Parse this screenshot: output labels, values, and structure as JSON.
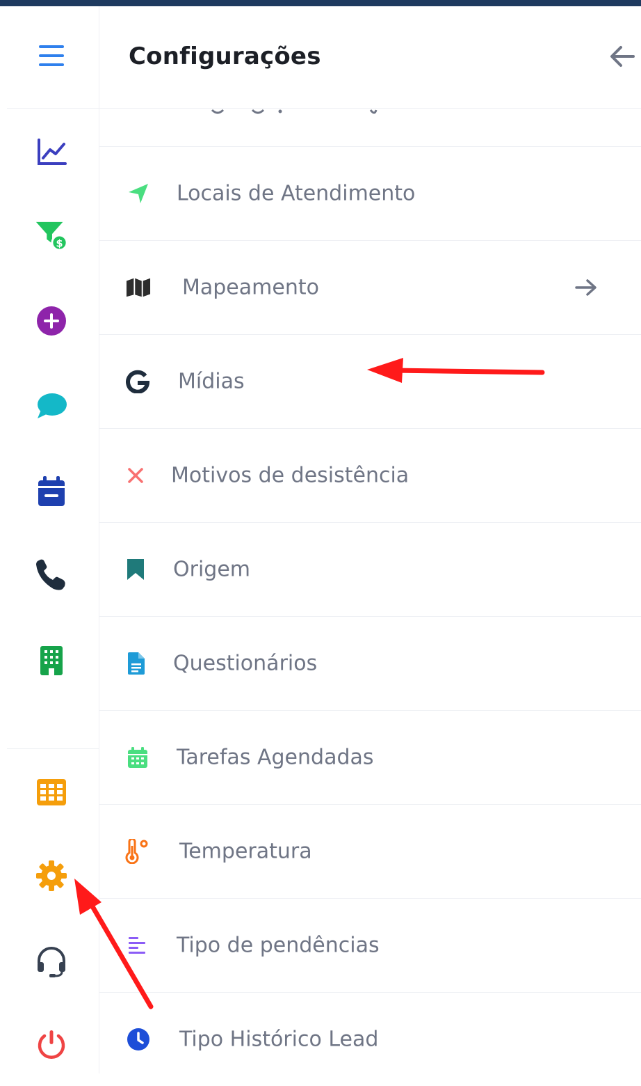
{
  "header": {
    "title": "Configurações",
    "back_icon": "arrow-left-icon"
  },
  "sidebar": {
    "top_items": [
      {
        "icon": "menu-icon",
        "color": "#2f80ed"
      },
      {
        "icon": "chart-line-icon",
        "color": "#3b3fbf"
      },
      {
        "icon": "funnel-dollar-icon",
        "color": "#22c55e"
      },
      {
        "icon": "plus-circle-icon",
        "color": "#8e24aa"
      },
      {
        "icon": "chat-bubble-icon",
        "color": "#14b8c8"
      },
      {
        "icon": "calendar-icon",
        "color": "#1e40af"
      },
      {
        "icon": "phone-icon",
        "color": "#1f2d3d"
      },
      {
        "icon": "building-icon",
        "color": "#16a34a"
      }
    ],
    "bottom_items": [
      {
        "icon": "grid-icon",
        "color": "#f59e0b"
      },
      {
        "icon": "gear-icon",
        "color": "#f59e0b"
      },
      {
        "icon": "headset-icon",
        "color": "#374151"
      },
      {
        "icon": "power-icon",
        "color": "#ef4444"
      }
    ]
  },
  "settings_list": {
    "items": [
      {
        "label": "Locais de Atendimento",
        "icon": "location-arrow-icon",
        "icon_color": "#4ade80"
      },
      {
        "label": "Mapeamento",
        "icon": "map-icon",
        "icon_color": "#2d2d2d",
        "has_arrow": true
      },
      {
        "label": "Mídias",
        "icon": "google-icon",
        "icon_color": "#1f2d3d"
      },
      {
        "label": "Motivos de desistência",
        "icon": "close-icon",
        "icon_color": "#f87171"
      },
      {
        "label": "Origem",
        "icon": "bookmark-icon",
        "icon_color": "#1f7a7a"
      },
      {
        "label": "Questionários",
        "icon": "document-icon",
        "icon_color": "#1e9bd7"
      },
      {
        "label": "Tarefas Agendadas",
        "icon": "calendar-grid-icon",
        "icon_color": "#4ade80"
      },
      {
        "label": "Temperatura",
        "icon": "thermometer-icon",
        "icon_color": "#f97316"
      },
      {
        "label": "Tipo de pendências",
        "icon": "align-left-icon",
        "icon_color": "#8b5cf6"
      },
      {
        "label": "Tipo Histórico Lead",
        "icon": "clock-icon",
        "icon_color": "#1d4ed8"
      }
    ]
  },
  "colors": {
    "label": "#6f7585",
    "divider": "#eef0f4",
    "annotation_arrow": "#ff1a1a",
    "topbar": "#1e3a5f"
  }
}
